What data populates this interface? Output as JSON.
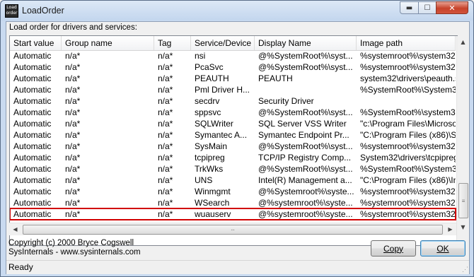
{
  "window": {
    "title": "LoadOrder",
    "icon_text": "Load order",
    "minimize_icon": "minimize-icon",
    "maximize_icon": "maximize-icon",
    "close_icon": "close-icon"
  },
  "caption": "Load order for drivers and services:",
  "columns": [
    "Start value",
    "Group name",
    "Tag",
    "Service/Device",
    "Display Name",
    "Image path"
  ],
  "rows": [
    [
      "Automatic",
      "n/a*",
      "n/a*",
      "nsi",
      "@%SystemRoot%\\syst...",
      "%systemroot%\\system32\\"
    ],
    [
      "Automatic",
      "n/a*",
      "n/a*",
      "PcaSvc",
      "@%SystemRoot%\\syst...",
      "%systemroot%\\system32\\"
    ],
    [
      "Automatic",
      "n/a*",
      "n/a*",
      "PEAUTH",
      "PEAUTH",
      "system32\\drivers\\peauth.s"
    ],
    [
      "Automatic",
      "n/a*",
      "n/a*",
      "Pml Driver H...",
      "",
      "%SystemRoot%\\System32\\"
    ],
    [
      "Automatic",
      "n/a*",
      "n/a*",
      "secdrv",
      "Security Driver",
      ""
    ],
    [
      "Automatic",
      "n/a*",
      "n/a*",
      "sppsvc",
      "@%SystemRoot%\\syst...",
      "%SystemRoot%\\system32\\"
    ],
    [
      "Automatic",
      "n/a*",
      "n/a*",
      "SQLWriter",
      "SQL Server VSS Writer",
      "\"c:\\Program Files\\Microso"
    ],
    [
      "Automatic",
      "n/a*",
      "n/a*",
      "Symantec A...",
      "Symantec Endpoint Pr...",
      "\"C:\\Program Files (x86)\\Sy"
    ],
    [
      "Automatic",
      "n/a*",
      "n/a*",
      "SysMain",
      "@%SystemRoot%\\syst...",
      "%systemroot%\\system32\\"
    ],
    [
      "Automatic",
      "n/a*",
      "n/a*",
      "tcpipreg",
      "TCP/IP Registry Comp...",
      "System32\\drivers\\tcpipreg"
    ],
    [
      "Automatic",
      "n/a*",
      "n/a*",
      "TrkWks",
      "@%SystemRoot%\\syst...",
      "%SystemRoot%\\System32\\"
    ],
    [
      "Automatic",
      "n/a*",
      "n/a*",
      "UNS",
      "Intel(R) Management a...",
      "\"C:\\Program Files (x86)\\In"
    ],
    [
      "Automatic",
      "n/a*",
      "n/a*",
      "Winmgmt",
      "@%Systemroot%\\syste...",
      "%systemroot%\\system32\\"
    ],
    [
      "Automatic",
      "n/a*",
      "n/a*",
      "WSearch",
      "@%systemroot%\\syste...",
      "%systemroot%\\system32\\"
    ],
    [
      "Automatic",
      "n/a*",
      "n/a*",
      "wuauserv",
      "@%systemroot%\\syste...",
      "%systemroot%\\system32"
    ]
  ],
  "selected_row_index": 14,
  "footer": {
    "copyright_line1": "Copyright (c) 2000 Bryce Cogswell",
    "copyright_line2": "SysInternals - www.sysinternals.com",
    "copy_label": "Copy",
    "ok_label": "OK"
  },
  "status": "Ready",
  "colors": {
    "selection_outline": "#d10000",
    "title_bar": "#c9daf0",
    "close_button": "#c7432b"
  }
}
